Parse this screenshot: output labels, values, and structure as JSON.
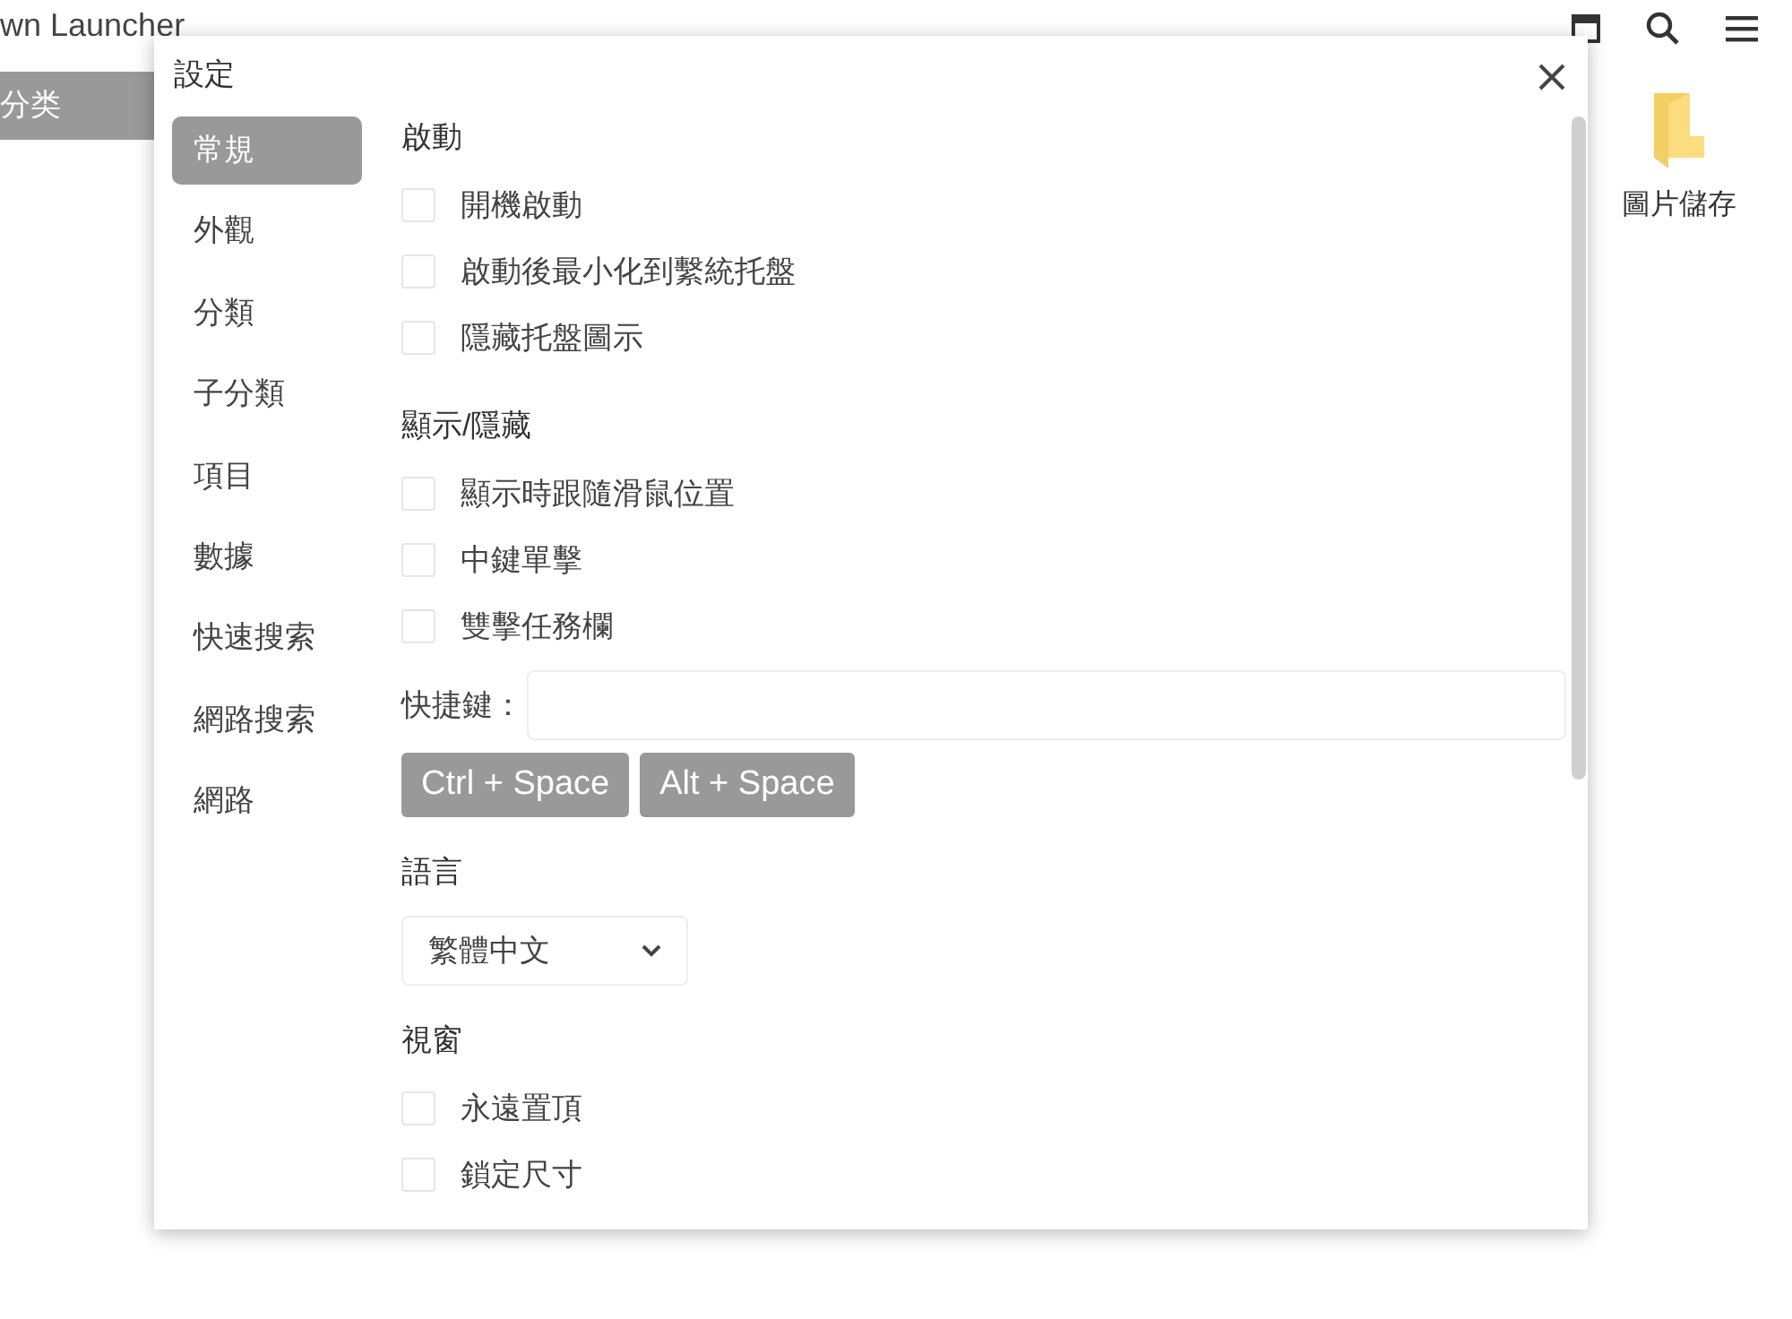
{
  "app": {
    "title": "wn Launcher",
    "sidebar_items": [
      {
        "label": "分类",
        "selected": true
      }
    ],
    "desktop_items": [
      {
        "label": "圖片儲存"
      }
    ]
  },
  "dialog": {
    "title": "設定",
    "nav": [
      {
        "label": "常規",
        "selected": true
      },
      {
        "label": "外觀",
        "selected": false
      },
      {
        "label": "分類",
        "selected": false
      },
      {
        "label": "子分類",
        "selected": false
      },
      {
        "label": "項目",
        "selected": false
      },
      {
        "label": "數據",
        "selected": false
      },
      {
        "label": "快速搜索",
        "selected": false
      },
      {
        "label": "網路搜索",
        "selected": false
      },
      {
        "label": "網路",
        "selected": false
      }
    ],
    "sections": [
      {
        "heading": "啟動",
        "items": [
          {
            "kind": "checkbox",
            "label": "開機啟動",
            "checked": false
          },
          {
            "kind": "checkbox",
            "label": "啟動後最小化到繫統托盤",
            "checked": false
          },
          {
            "kind": "checkbox",
            "label": "隱藏托盤圖示",
            "checked": false
          }
        ]
      },
      {
        "heading": "顯示/隱藏",
        "items": [
          {
            "kind": "checkbox",
            "label": "顯示時跟隨滑鼠位置",
            "checked": false
          },
          {
            "kind": "checkbox",
            "label": "中鍵單擊",
            "checked": false
          },
          {
            "kind": "checkbox",
            "label": "雙擊任務欄",
            "checked": false
          },
          {
            "kind": "field",
            "label": "快捷鍵："
          },
          {
            "kind": "buttons",
            "buttons": [
              "Ctrl + Space",
              "Alt + Space"
            ]
          }
        ]
      },
      {
        "heading": "語言",
        "items": [
          {
            "kind": "select",
            "value": "繁體中文"
          }
        ]
      },
      {
        "heading": "視窗",
        "items": [
          {
            "kind": "checkbox",
            "label": "永遠置頂",
            "checked": false
          },
          {
            "kind": "checkbox",
            "label": "鎖定尺寸",
            "checked": false
          }
        ]
      }
    ]
  }
}
